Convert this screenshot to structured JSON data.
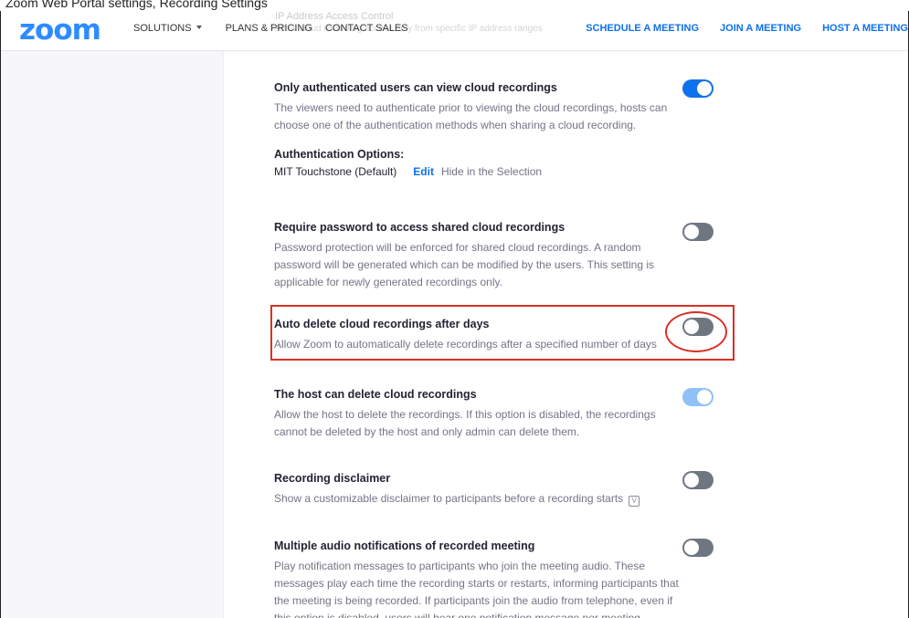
{
  "caption": "Zoom Web Portal settings, Recording Settings",
  "header": {
    "logo": "zoom",
    "nav_left": [
      "SOLUTIONS",
      "PLANS & PRICING",
      "CONTACT SALES"
    ],
    "nav_right": [
      "SCHEDULE A MEETING",
      "JOIN A MEETING",
      "HOST A MEETING"
    ],
    "behind_title": "IP Address Access Control",
    "behind_desc": "Allow cloud recording access only from specific IP address ranges"
  },
  "settings": [
    {
      "title": "Only authenticated users can view cloud recordings",
      "desc": "The viewers need to authenticate prior to viewing the cloud recordings, hosts can choose one of the authentication methods when sharing a cloud recording.",
      "toggle": "on"
    },
    {
      "title": "Require password to access shared cloud recordings",
      "desc": "Password protection will be enforced for shared cloud recordings. A random password will be generated which can be modified by the users. This setting is applicable for newly generated recordings only.",
      "toggle": "off"
    },
    {
      "title": "Auto delete cloud recordings after days",
      "desc": "Allow Zoom to automatically delete recordings after a specified number of days",
      "toggle": "off"
    },
    {
      "title": "The host can delete cloud recordings",
      "desc": "Allow the host to delete the recordings. If this option is disabled, the recordings cannot be deleted by the host and only admin can delete them.",
      "toggle": "on-disabled"
    },
    {
      "title": "Recording disclaimer",
      "desc": "Show a customizable disclaimer to participants before a recording starts",
      "toggle": "off"
    },
    {
      "title": "Multiple audio notifications of recorded meeting",
      "desc": "Play notification messages to participants who join the meeting audio. These messages play each time the recording starts or restarts, informing participants that the meeting is being recorded. If participants join the audio from telephone, even if this option is disabled, users will hear one notification message per meeting.",
      "toggle": "off"
    }
  ],
  "auth": {
    "heading": "Authentication Options:",
    "option": "MIT Touchstone (Default)",
    "edit": "Edit",
    "hide": "Hide in the Selection"
  },
  "colors": {
    "brand_blue": "#2d8cff",
    "link_blue": "#0e71eb",
    "toggle_on": "#0e72ed",
    "toggle_off": "#6e7680",
    "toggle_disabled": "#8fc1f7",
    "highlight_red": "#d93025"
  },
  "icons": {
    "inline_info": "v-box-icon"
  }
}
